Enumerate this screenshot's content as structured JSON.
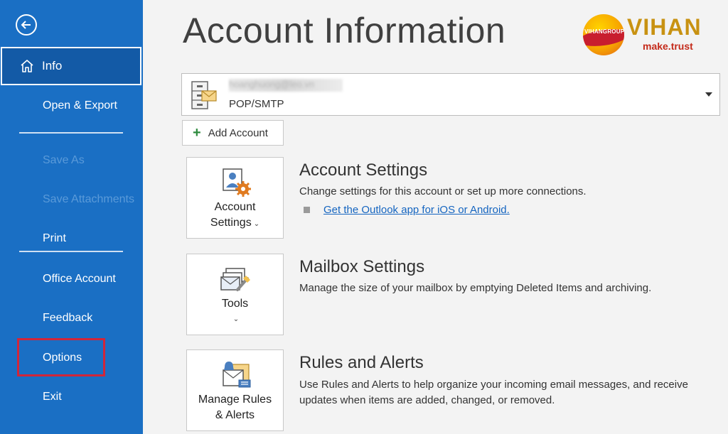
{
  "sidebar": {
    "items": [
      {
        "label": "Info"
      },
      {
        "label": "Open & Export"
      },
      {
        "label": "Save As"
      },
      {
        "label": "Save Attachments"
      },
      {
        "label": "Print"
      },
      {
        "label": "Office Account"
      },
      {
        "label": "Feedback"
      },
      {
        "label": "Options"
      },
      {
        "label": "Exit"
      }
    ]
  },
  "main": {
    "title": "Account Information",
    "logo": {
      "brand": "VIHAN",
      "group": "VIHANGROUP",
      "tagline": "make.trust"
    },
    "account": {
      "email": "hoanghuong@leo.vn",
      "type": "POP/SMTP"
    },
    "add_account_label": "Add Account",
    "sections": [
      {
        "tile_line1": "Account",
        "tile_line2": "Settings",
        "title": "Account Settings",
        "desc": "Change settings for this account or set up more connections.",
        "link": "Get the Outlook app for iOS or Android."
      },
      {
        "tile_line1": "Tools",
        "title": "Mailbox Settings",
        "desc": "Manage the size of your mailbox by emptying Deleted Items and archiving."
      },
      {
        "tile_line1": "Manage Rules",
        "tile_line2": "& Alerts",
        "title": "Rules and Alerts",
        "desc": "Use Rules and Alerts to help organize your incoming email messages, and receive updates when items are added, changed, or removed."
      }
    ]
  },
  "colors": {
    "sidebar": "#1a6fc4",
    "sidebar_active": "#135aa6",
    "link": "#1565c0",
    "highlight": "#d1263a"
  }
}
